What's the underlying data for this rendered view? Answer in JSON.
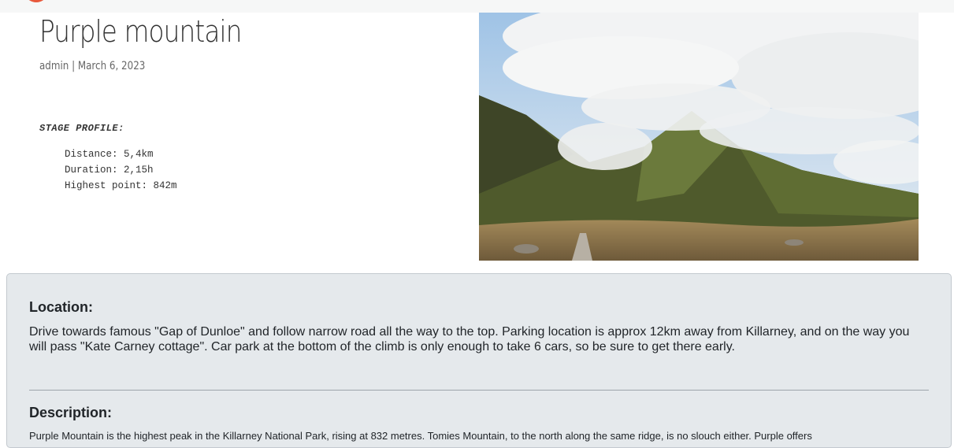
{
  "post": {
    "title": "Purple mountain",
    "meta": "admin | March 6, 2023"
  },
  "stage_profile": {
    "heading": "STAGE PROFILE:",
    "distance": "Distance: 5,4km",
    "duration": "Duration: 2,15h",
    "highest_point": "Highest point: 842m"
  },
  "location": {
    "heading": "Location:",
    "text": "Drive towards famous \"Gap of Dunloe\" and follow narrow road all the way to the top. Parking location is approx 12km away from Killarney, and on the way you will pass \"Kate Carney cottage\". Car park at the bottom of the climb is only enough to take 6 cars, so be sure to get there early."
  },
  "description": {
    "heading": "Description:",
    "text": "Purple Mountain is the highest peak in the Killarney National Park, rising at 832 metres. Tomies Mountain, to the north along the same ridge, is no slouch either. Purple offers"
  },
  "colors": {
    "card_background": "#e5e9ec",
    "logo_accent": "#e8593c"
  }
}
